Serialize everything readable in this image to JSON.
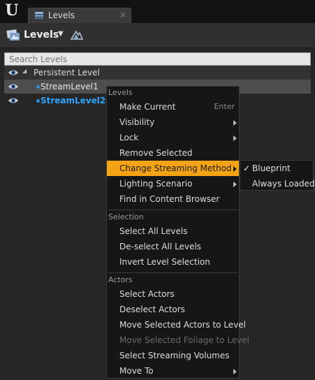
{
  "tab": {
    "label": "Levels",
    "close": "×"
  },
  "toolbar": {
    "levels_label": "Levels"
  },
  "search": {
    "placeholder": "Search Levels"
  },
  "tree": {
    "persistent": "Persistent Level",
    "levels": [
      "StreamLevel1",
      "StreamLevel2"
    ]
  },
  "menu": {
    "sections": [
      {
        "header": "Levels",
        "items": [
          {
            "label": "Make Current",
            "shortcut": "Enter",
            "submenu": false,
            "enabled": true
          },
          {
            "label": "Visibility",
            "submenu": true,
            "enabled": true
          },
          {
            "label": "Lock",
            "submenu": true,
            "enabled": true
          },
          {
            "label": "Remove Selected",
            "submenu": false,
            "enabled": true
          },
          {
            "label": "Change Streaming Method",
            "submenu": true,
            "enabled": true,
            "highlighted": true
          },
          {
            "label": "Lighting Scenario",
            "submenu": true,
            "enabled": true
          },
          {
            "label": "Find in Content Browser",
            "submenu": false,
            "enabled": true
          }
        ]
      },
      {
        "header": "Selection",
        "items": [
          {
            "label": "Select All Levels",
            "enabled": true
          },
          {
            "label": "De-select All Levels",
            "enabled": true
          },
          {
            "label": "Invert Level Selection",
            "enabled": true
          }
        ]
      },
      {
        "header": "Actors",
        "items": [
          {
            "label": "Select Actors",
            "enabled": true
          },
          {
            "label": "Deselect Actors",
            "enabled": true
          },
          {
            "label": "Move Selected Actors to Level",
            "enabled": true
          },
          {
            "label": "Move Selected Foliage to Level",
            "enabled": false
          },
          {
            "label": "Select Streaming Volumes",
            "enabled": true
          },
          {
            "label": "Move To",
            "submenu": true,
            "enabled": true
          }
        ]
      }
    ]
  },
  "submenu": {
    "items": [
      {
        "label": "Blueprint",
        "checked": true,
        "check": "✓"
      },
      {
        "label": "Always Loaded",
        "checked": false
      }
    ]
  },
  "colors": {
    "highlight": "#f3a314",
    "selected_level": "#2ea4ff"
  }
}
